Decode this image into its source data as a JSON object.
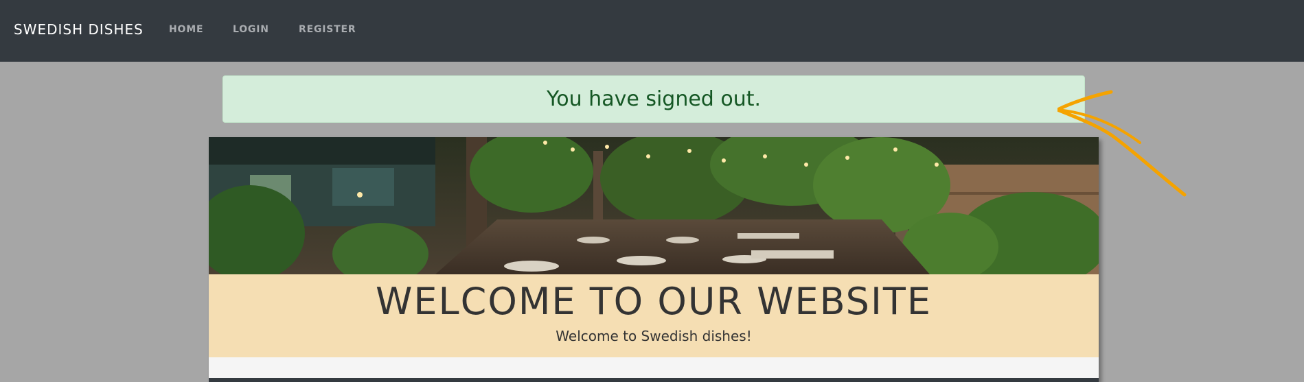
{
  "navbar": {
    "brand": "SWEDISH DISHES",
    "links": [
      {
        "label": "HOME"
      },
      {
        "label": "LOGIN"
      },
      {
        "label": "REGISTER"
      }
    ]
  },
  "alert": {
    "message": "You have signed out."
  },
  "hero": {
    "image": "restaurant-patio-photo",
    "title": "WELCOME TO OUR WEBSITE",
    "subtitle": "Welcome to Swedish dishes!"
  },
  "colors": {
    "navbar_bg": "#343a40",
    "page_bg": "#a6a6a6",
    "alert_bg": "#d4edda",
    "alert_text": "#155724",
    "welcome_bg": "#f5deb3",
    "annotation_arrow": "#f5a300"
  },
  "annotation": {
    "icon": "hand-drawn-arrow-icon"
  }
}
